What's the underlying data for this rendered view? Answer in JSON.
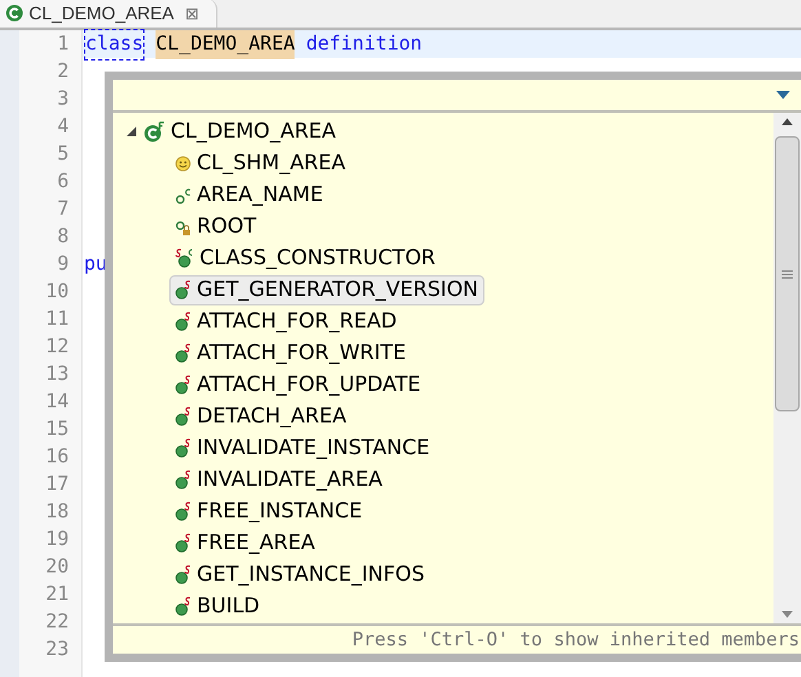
{
  "tab": {
    "title": "CL_DEMO_AREA",
    "close": "⊠"
  },
  "editor": {
    "lines": [
      {
        "number": "1",
        "tokens": [
          {
            "kind": "keyword",
            "text": "class",
            "boxed": true
          },
          {
            "kind": "name",
            "text": "CL_DEMO_AREA",
            "boxed": false
          },
          {
            "kind": "keyword",
            "text": "definition",
            "boxed": false
          }
        ],
        "current": true
      },
      {
        "number": "2",
        "current": false
      },
      {
        "number": "3",
        "current": false
      },
      {
        "number": "4",
        "current": false
      },
      {
        "number": "5",
        "current": false
      },
      {
        "number": "6",
        "current": false
      },
      {
        "number": "7",
        "current": false
      },
      {
        "number": "8",
        "current": false
      },
      {
        "number": "9",
        "tokens": [
          {
            "kind": "keyword",
            "text": "pu",
            "boxed": false
          }
        ],
        "current": false
      },
      {
        "number": "10",
        "current": false
      },
      {
        "number": "11",
        "current": false
      },
      {
        "number": "12",
        "current": false
      },
      {
        "number": "13",
        "current": false
      },
      {
        "number": "14",
        "current": false
      },
      {
        "number": "15",
        "current": false
      },
      {
        "number": "16",
        "current": false
      },
      {
        "number": "17",
        "current": false
      },
      {
        "number": "18",
        "current": false
      },
      {
        "number": "19",
        "current": false
      },
      {
        "number": "20",
        "current": false
      },
      {
        "number": "21",
        "current": false
      },
      {
        "number": "22",
        "current": false
      },
      {
        "number": "23",
        "current": false
      }
    ]
  },
  "outline": {
    "root": {
      "label": "CL_DEMO_AREA",
      "kind": "class",
      "expanded": true,
      "children": [
        {
          "label": "CL_SHM_AREA",
          "kind": "superclass",
          "selected": false
        },
        {
          "label": "AREA_NAME",
          "kind": "constant",
          "selected": false
        },
        {
          "label": "ROOT",
          "kind": "private_attribute",
          "selected": false
        },
        {
          "label": "CLASS_CONSTRUCTOR",
          "kind": "static_constructor",
          "selected": false
        },
        {
          "label": "GET_GENERATOR_VERSION",
          "kind": "static_method",
          "selected": true
        },
        {
          "label": "ATTACH_FOR_READ",
          "kind": "static_method",
          "selected": false
        },
        {
          "label": "ATTACH_FOR_WRITE",
          "kind": "static_method",
          "selected": false
        },
        {
          "label": "ATTACH_FOR_UPDATE",
          "kind": "static_method",
          "selected": false
        },
        {
          "label": "DETACH_AREA",
          "kind": "static_method",
          "selected": false
        },
        {
          "label": "INVALIDATE_INSTANCE",
          "kind": "static_method",
          "selected": false
        },
        {
          "label": "INVALIDATE_AREA",
          "kind": "static_method",
          "selected": false
        },
        {
          "label": "FREE_INSTANCE",
          "kind": "static_method",
          "selected": false
        },
        {
          "label": "FREE_AREA",
          "kind": "static_method",
          "selected": false
        },
        {
          "label": "GET_INSTANCE_INFOS",
          "kind": "static_method",
          "selected": false
        },
        {
          "label": "BUILD",
          "kind": "static_method",
          "selected": false
        }
      ]
    },
    "hint": "Press 'Ctrl-O' to show inherited members"
  }
}
